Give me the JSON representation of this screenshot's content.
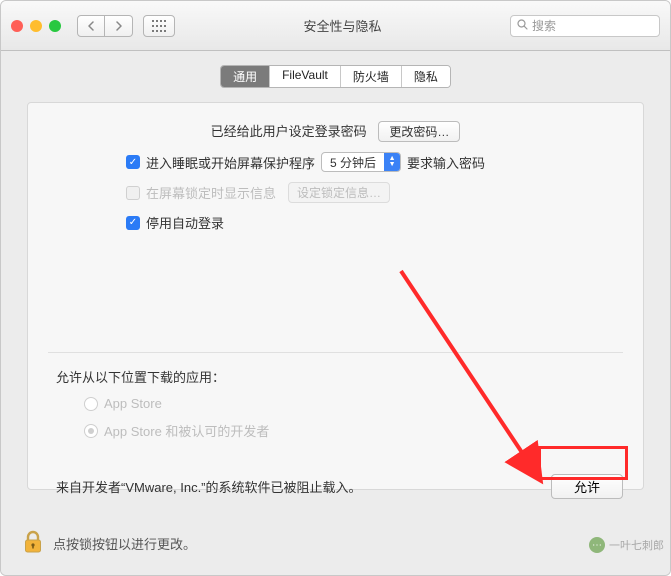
{
  "window": {
    "title": "安全性与隐私"
  },
  "toolbar": {
    "search_placeholder": "搜索"
  },
  "tabs": [
    {
      "label": "通用",
      "active": true
    },
    {
      "label": "FileVault",
      "active": false
    },
    {
      "label": "防火墙",
      "active": false
    },
    {
      "label": "隐私",
      "active": false
    }
  ],
  "panel": {
    "password_set_text": "已经给此用户设定登录密码",
    "change_password_label": "更改密码…",
    "require_password_prefix": "进入睡眠或开始屏幕保护程序",
    "require_password_select": "5 分钟后",
    "require_password_suffix": "要求输入密码",
    "show_message_label": "在屏幕锁定时显示信息",
    "set_lock_message_label": "设定锁定信息…",
    "disable_autologin_label": "停用自动登录",
    "allow_from_label": "允许从以下位置下载的应用：",
    "radio_appstore": "App Store",
    "radio_identified": "App Store 和被认可的开发者",
    "blocked_text": "来自开发者“VMware, Inc.”的系统软件已被阻止载入。",
    "allow_button": "允许"
  },
  "footer": {
    "lock_text": "点按锁按钮以进行更改。"
  },
  "watermark": {
    "text": "一叶七刺郎"
  }
}
